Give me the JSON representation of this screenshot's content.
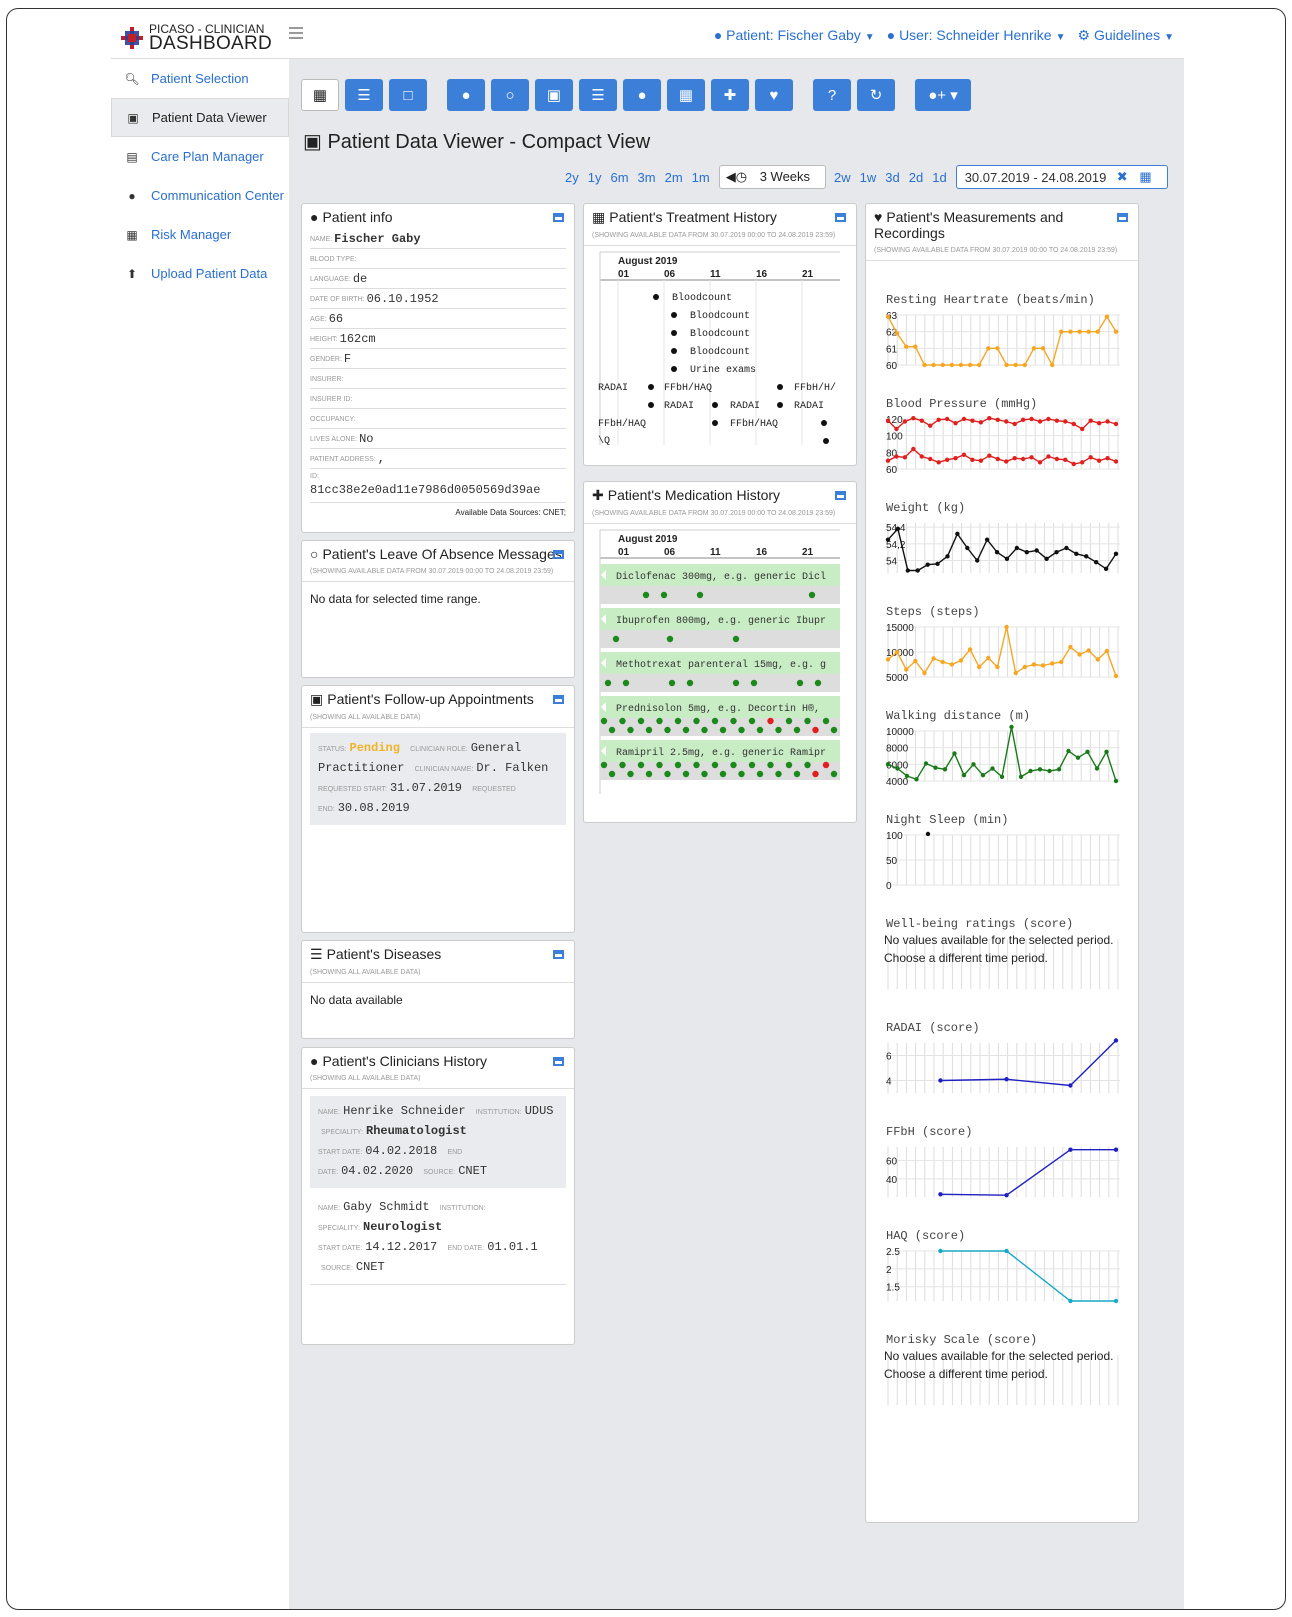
{
  "header": {
    "logo_line1": "PICASO - CLINICIAN",
    "logo_line2": "DASHBOARD",
    "patient_menu": "Patient: Fischer Gaby",
    "user_menu": "User: Schneider Henrike",
    "guidelines_menu": "Guidelines"
  },
  "sidebar": {
    "items": [
      {
        "label": "Patient Selection",
        "icon": "search-icon"
      },
      {
        "label": "Patient Data Viewer",
        "icon": "viewer-icon"
      },
      {
        "label": "Care Plan Manager",
        "icon": "list-icon"
      },
      {
        "label": "Communication Center",
        "icon": "chat-icon"
      },
      {
        "label": "Risk Manager",
        "icon": "calculator-icon"
      },
      {
        "label": "Upload Patient Data",
        "icon": "upload-icon"
      }
    ]
  },
  "page_title": "Patient Data Viewer - Compact View",
  "range": {
    "options": [
      "2y",
      "1y",
      "6m",
      "3m",
      "2m",
      "1m"
    ],
    "selected": "3 Weeks",
    "options_after": [
      "2w",
      "1w",
      "3d",
      "2d",
      "1d"
    ],
    "date_range": "30.07.2019 - 24.08.2019"
  },
  "patient_info": {
    "title": "Patient info",
    "fields": [
      {
        "k": "NAME:",
        "v": "Fischer Gaby"
      },
      {
        "k": "BLOOD TYPE:",
        "v": ""
      },
      {
        "k": "LANGUAGE:",
        "v": "de"
      },
      {
        "k": "DATE OF BIRTH:",
        "v": "06.10.1952"
      },
      {
        "k": "AGE:",
        "v": "66"
      },
      {
        "k": "HEIGHT:",
        "v": "162cm"
      },
      {
        "k": "GENDER:",
        "v": "F"
      },
      {
        "k": "INSURER:",
        "v": ""
      },
      {
        "k": "INSURER ID:",
        "v": ""
      },
      {
        "k": "OCCUPANCY:",
        "v": ""
      },
      {
        "k": "LIVES ALONE:",
        "v": "No"
      },
      {
        "k": "PATIENT ADDRESS:",
        "v": ","
      },
      {
        "k": "ID:",
        "v": "81cc38e2e0ad11e7986d0050569d39ae"
      }
    ],
    "sources": "Available Data Sources: CNET;"
  },
  "leave": {
    "title": "Patient's Leave Of Absence Messages",
    "sub": "(SHOWING AVAILABLE DATA FROM 30.07.2019 00:00 TO 24.08.2019 23:59)",
    "nodata": "No data for selected time range."
  },
  "followup": {
    "title": "Patient's Follow-up Appointments",
    "sub": "(SHOWING ALL AVAILABLE DATA)",
    "status_k": "STATUS:",
    "status_v": "Pending",
    "role_k": "CLINICIAN ROLE:",
    "role_v": "General Practitioner",
    "name_k": "CLINICIAN NAME:",
    "name_v": "Dr. Falken",
    "start_k": "REQUESTED START:",
    "start_v": "31.07.2019",
    "end_k": "REQUESTED END:",
    "end_v": "30.08.2019"
  },
  "diseases": {
    "title": "Patient's Diseases",
    "sub": "(SHOWING ALL AVAILABLE DATA)",
    "nodata": "No data available"
  },
  "clinicians": {
    "title": "Patient's Clinicians History",
    "sub": "(SHOWING ALL AVAILABLE DATA)",
    "entries": [
      {
        "name": "Henrike Schneider",
        "institution": "UDUS",
        "speciality": "Rheumatologist",
        "start": "04.02.2018",
        "end": "04.02.2020",
        "source": "CNET"
      },
      {
        "name": "Gaby Schmidt",
        "institution": "",
        "speciality": "Neurologist",
        "start": "14.12.2017",
        "end": "01.01.1",
        "source": "CNET"
      }
    ],
    "labels": {
      "name": "NAME:",
      "institution": "INSTITUTION:",
      "speciality": "SPECIALITY:",
      "start": "START DATE:",
      "end": "END DATE:",
      "source": "SOURCE:"
    }
  },
  "treatment": {
    "title": "Patient's Treatment History",
    "sub": "(SHOWING AVAILABLE DATA FROM 30.07.2019 00:00 TO 24.08.2019 23:59)",
    "month": "August 2019",
    "ticks": [
      "01",
      "06",
      "11",
      "16",
      "21"
    ],
    "events": [
      "Bloodcount",
      "Bloodcount",
      "Bloodcount",
      "Bloodcount",
      "Urine exams",
      "RADAI",
      "FFbH/HAQ",
      "FFbH/H/",
      "RADAI",
      "RADAI",
      "RADAI",
      "FFbH/HAQ",
      "FFbH/HAQ",
      "\\Q"
    ]
  },
  "medication": {
    "title": "Patient's Medication History",
    "sub": "(SHOWING AVAILABLE DATA FROM 30.07.2019 00:00 TO 24.08.2019 23:59)",
    "month": "August 2019",
    "ticks": [
      "01",
      "06",
      "11",
      "16",
      "21"
    ],
    "drugs": [
      "Diclofenac 300mg, e.g. generic Dicl",
      "Ibuprofen 800mg, e.g. generic Ibupr",
      "Methotrexat parenteral 15mg, e.g. g",
      "Prednisolon 5mg, e.g. Decortin H®,",
      "Ramipril 2.5mg, e.g. generic Ramipr"
    ]
  },
  "measurements": {
    "title": "Patient's Measurements and Recordings",
    "sub": "(SHOWING AVAILABLE DATA FROM 30.07.2019 00:00 TO 24.08.2019 23:59)",
    "no_values": "No values available for the selected period. Choose a different time period."
  },
  "chart_data": [
    {
      "type": "line",
      "title": "Resting Heartrate (beats/min)",
      "yticks": [
        "63",
        "62",
        "61",
        "60"
      ],
      "ylim": [
        60,
        63
      ],
      "color": "#f5a623",
      "series": [
        {
          "values": [
            62.9,
            61.9,
            61.1,
            61.1,
            60,
            60,
            60,
            60,
            60,
            60,
            60,
            61,
            61,
            60,
            60,
            60,
            61,
            61,
            60,
            62,
            62,
            62,
            62,
            62,
            62.9,
            62
          ]
        }
      ]
    },
    {
      "type": "line",
      "title": "Blood Pressure (mmHg)",
      "yticks": [
        "120",
        "100",
        "80",
        "60"
      ],
      "ylim": [
        60,
        120
      ],
      "color": "#e02020",
      "series": [
        {
          "values": [
            118,
            108,
            117,
            121,
            118,
            112,
            119,
            120,
            115,
            120,
            118,
            116,
            121,
            119,
            117,
            114,
            119,
            120,
            117,
            120,
            118,
            117,
            114,
            108,
            118,
            115,
            117,
            114
          ]
        },
        {
          "values": [
            70,
            75,
            74,
            84,
            75,
            72,
            68,
            71,
            73,
            77,
            71,
            70,
            76,
            72,
            69,
            73,
            72,
            74,
            68,
            75,
            72,
            71,
            66,
            68,
            74,
            70,
            73,
            69
          ]
        }
      ]
    },
    {
      "type": "line",
      "title": "Weight (kg)",
      "yticks": [
        "54,4",
        "54,2",
        "54"
      ],
      "ylim": [
        53.85,
        54.45
      ],
      "color": "#111",
      "series": [
        {
          "values": [
            54.25,
            54.38,
            53.88,
            53.88,
            53.95,
            53.96,
            54.05,
            54.32,
            54.15,
            54.0,
            54.25,
            54.1,
            54.02,
            54.15,
            54.1,
            54.12,
            54.02,
            54.1,
            54.15,
            54.08,
            54.05,
            53.98,
            53.9,
            54.08
          ]
        }
      ]
    },
    {
      "type": "line",
      "title": "Steps (steps)",
      "yticks": [
        "15000",
        "10000",
        "5000"
      ],
      "ylim": [
        5000,
        15000
      ],
      "color": "#f5a623",
      "series": [
        {
          "values": [
            8500,
            10000,
            6500,
            8200,
            5800,
            8700,
            8000,
            7500,
            8300,
            10500,
            7000,
            8800,
            7000,
            15000,
            5800,
            7000,
            7500,
            7300,
            7700,
            8000,
            11000,
            9500,
            10300,
            8500,
            10200,
            5200
          ]
        }
      ]
    },
    {
      "type": "line",
      "title": "Walking distance (m)",
      "yticks": [
        "10000",
        "8000",
        "6000",
        "4000"
      ],
      "ylim": [
        4000,
        10000
      ],
      "color": "#1a7a1a",
      "series": [
        {
          "values": [
            6000,
            5500,
            4600,
            4200,
            6100,
            5600,
            5400,
            7300,
            4700,
            6000,
            4700,
            5500,
            4500,
            11000,
            4500,
            5200,
            5400,
            5200,
            5400,
            7600,
            6800,
            7500,
            5500,
            7500,
            4000
          ]
        }
      ]
    },
    {
      "type": "scatter",
      "title": "Night Sleep (min)",
      "yticks": [
        "100",
        "50",
        "0"
      ],
      "ylim": [
        0,
        100
      ],
      "color": "#111",
      "series": [
        {
          "values": [
            102
          ]
        }
      ]
    },
    {
      "type": "line",
      "title": "Well-being ratings (score)",
      "yticks": [],
      "series": []
    },
    {
      "type": "line",
      "title": "RADAI (score)",
      "yticks": [
        "6",
        "4"
      ],
      "ylim": [
        3,
        7
      ],
      "color": "#2020c0",
      "series": [
        {
          "x": [
            0.23,
            0.52,
            0.8,
            1.0
          ],
          "values": [
            4,
            4.1,
            3.6,
            7.2
          ]
        }
      ]
    },
    {
      "type": "line",
      "title": "FFbH (score)",
      "yticks": [
        "60",
        "40"
      ],
      "ylim": [
        20,
        75
      ],
      "color": "#2020c0",
      "series": [
        {
          "x": [
            0.23,
            0.52,
            0.8,
            1.0
          ],
          "values": [
            23,
            22,
            72,
            72
          ]
        }
      ]
    },
    {
      "type": "line",
      "title": "HAQ (score)",
      "yticks": [
        "2.5",
        "2",
        "1.5"
      ],
      "ylim": [
        1.1,
        2.5
      ],
      "color": "#18a8c8",
      "series": [
        {
          "x": [
            0.23,
            0.52,
            0.8,
            1.0
          ],
          "values": [
            2.5,
            2.5,
            1.1,
            1.1
          ]
        }
      ]
    },
    {
      "type": "line",
      "title": "Morisky Scale (score)",
      "yticks": [],
      "series": []
    }
  ]
}
